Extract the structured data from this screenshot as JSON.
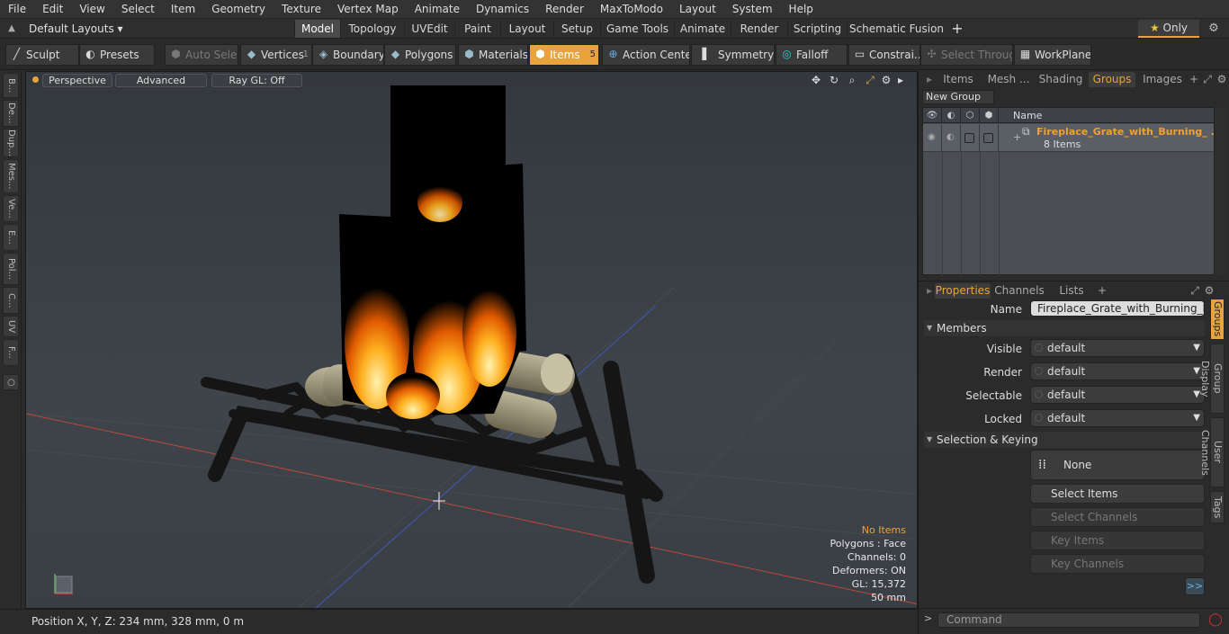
{
  "menu": [
    "File",
    "Edit",
    "View",
    "Select",
    "Item",
    "Geometry",
    "Texture",
    "Vertex Map",
    "Animate",
    "Dynamics",
    "Render",
    "MaxToModo",
    "Layout",
    "System",
    "Help"
  ],
  "layout_tabs": {
    "dropdown": "Default Layouts",
    "tabs": [
      "Model",
      "Topology",
      "UVEdit",
      "Paint",
      "Layout",
      "Setup",
      "Game Tools",
      "Animate",
      "Render",
      "Scripting",
      "Schematic Fusion"
    ],
    "active": "Model",
    "only_label": "Only"
  },
  "toolbar": {
    "sculpt": "Sculpt",
    "presets": "Presets",
    "auto_select": "Auto Select",
    "vertices": "Vertices",
    "vertices_count": "1",
    "boundary": "Boundary",
    "polygons": "Polygons",
    "materials": "Materials",
    "items": "Items",
    "items_count": "5",
    "action_center": "Action Center",
    "symmetry": "Symmetry",
    "falloff": "Falloff",
    "constraints": "Constrai...",
    "select_through": "Select Through",
    "workplane": "WorkPlane"
  },
  "left_tabs": [
    "B...",
    "De...",
    "Dup...",
    "Mes...",
    "Ve...",
    "E...",
    "Pol...",
    "C...",
    "UV",
    "F..."
  ],
  "viewport": {
    "perspective": "Perspective",
    "advanced": "Advanced",
    "raygl": "Ray GL: Off",
    "info": {
      "selection": "No Items",
      "polygons": "Polygons : Face",
      "channels": "Channels: 0",
      "deformers": "Deformers: ON",
      "gl": "GL: 15,372",
      "scale": "50 mm"
    }
  },
  "status": {
    "position": "Position X, Y, Z:  234 mm, 328 mm, 0 m"
  },
  "right_panel": {
    "tabs": [
      "Items",
      "Mesh ...",
      "Shading",
      "Groups",
      "Images"
    ],
    "active_tab": "Groups",
    "new_group": "New Group",
    "grid_header_name": "Name",
    "group_name": "Fireplace_Grate_with_Burning_ ...",
    "group_count": "8 Items"
  },
  "properties": {
    "tabs": [
      "Properties",
      "Channels",
      "Lists"
    ],
    "active_tab": "Properties",
    "name_label": "Name",
    "name_value": "Fireplace_Grate_with_Burning_Logs (",
    "members_section": "Members",
    "visible_label": "Visible",
    "visible_value": "default",
    "render_label": "Render",
    "render_value": "default",
    "selectable_label": "Selectable",
    "selectable_value": "default",
    "locked_label": "Locked",
    "locked_value": "default",
    "selkey_section": "Selection & Keying",
    "none_label": "None",
    "select_items": "Select Items",
    "select_channels": "Select Channels",
    "key_items": "Key Items",
    "key_channels": "Key Channels",
    "more": ">>",
    "side_tabs": [
      "Groups",
      "Group Display",
      "User Channels",
      "Tags"
    ]
  },
  "command": {
    "placeholder": "Command"
  }
}
